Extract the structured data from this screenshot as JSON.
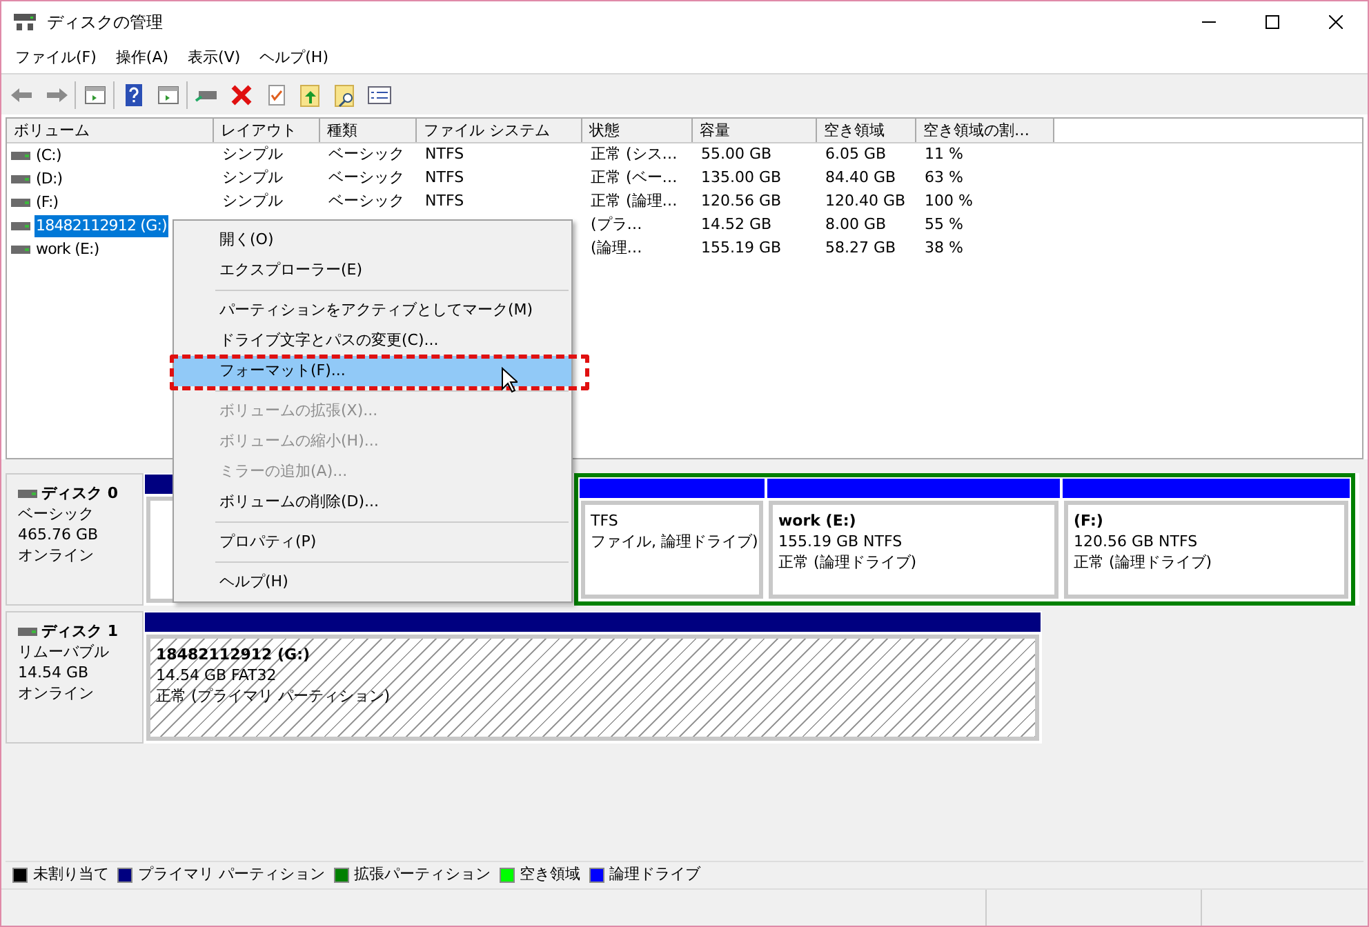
{
  "window": {
    "title": "ディスクの管理"
  },
  "menu_bar": [
    "ファイル(F)",
    "操作(A)",
    "表示(V)",
    "ヘルプ(H)"
  ],
  "table": {
    "columns": [
      "ボリューム",
      "レイアウト",
      "種類",
      "ファイル システム",
      "状態",
      "容量",
      "空き領域",
      "空き領域の割…"
    ],
    "rows": [
      {
        "selected": false,
        "cells": [
          "(C:)",
          "シンプル",
          "ベーシック",
          "NTFS",
          "正常 (シス…",
          "55.00 GB",
          "6.05 GB",
          "11 %"
        ]
      },
      {
        "selected": false,
        "cells": [
          "(D:)",
          "シンプル",
          "ベーシック",
          "NTFS",
          "正常 (ベー…",
          "135.00 GB",
          "84.40 GB",
          "63 %"
        ]
      },
      {
        "selected": false,
        "cells": [
          "(F:)",
          "シンプル",
          "ベーシック",
          "NTFS",
          "正常 (論理…",
          "120.56 GB",
          "120.40 GB",
          "100 %"
        ]
      },
      {
        "selected": true,
        "cells": [
          "18482112912 (G:)",
          "",
          "",
          "",
          "(プラ…",
          "14.52 GB",
          "8.00 GB",
          "55 %"
        ]
      },
      {
        "selected": false,
        "cells": [
          "work (E:)",
          "",
          "",
          "",
          "(論理…",
          "155.19 GB",
          "58.27 GB",
          "38 %"
        ]
      }
    ]
  },
  "disks": [
    {
      "name": "ディスク 0",
      "type": "ベーシック",
      "size": "465.76 GB",
      "status": "オンライン",
      "partitions": [
        {
          "color": "#000080"
        },
        {
          "color": "#0000ff",
          "extended": true,
          "lines": [
            "TFS",
            "ファイル, 論理ドライブ)"
          ]
        },
        {
          "color": "#0000ff",
          "extended": true,
          "title": "work  (E:)",
          "lines": [
            "155.19 GB NTFS",
            "正常 (論理ドライブ)"
          ]
        },
        {
          "color": "#0000ff",
          "extended": true,
          "title": "(F:)",
          "lines": [
            "120.56 GB NTFS",
            "正常 (論理ドライブ)"
          ]
        }
      ]
    },
    {
      "name": "ディスク 1",
      "type": "リムーバブル",
      "size": "14.54 GB",
      "status": "オンライン",
      "partitions": [
        {
          "color": "#000080",
          "hatched": true,
          "title": "18482112912  (G:)",
          "lines": [
            "14.54 GB FAT32",
            "正常 (プライマリ パーティション)"
          ]
        }
      ]
    }
  ],
  "context_menu": [
    {
      "kind": "item",
      "label": "開く(O)",
      "disabled": false,
      "selected": false
    },
    {
      "kind": "item",
      "label": "エクスプローラー(E)",
      "disabled": false,
      "selected": false
    },
    {
      "kind": "separator"
    },
    {
      "kind": "item",
      "label": "パーティションをアクティブとしてマーク(M)",
      "disabled": false,
      "selected": false
    },
    {
      "kind": "item",
      "label": "ドライブ文字とパスの変更(C)...",
      "disabled": false,
      "selected": false
    },
    {
      "kind": "item",
      "label": "フォーマット(F)...",
      "disabled": false,
      "selected": true
    },
    {
      "kind": "separator"
    },
    {
      "kind": "item",
      "label": "ボリュームの拡張(X)...",
      "disabled": true,
      "selected": false
    },
    {
      "kind": "item",
      "label": "ボリュームの縮小(H)...",
      "disabled": true,
      "selected": false
    },
    {
      "kind": "item",
      "label": "ミラーの追加(A)...",
      "disabled": true,
      "selected": false
    },
    {
      "kind": "item",
      "label": "ボリュームの削除(D)...",
      "disabled": false,
      "selected": false
    },
    {
      "kind": "separator"
    },
    {
      "kind": "item",
      "label": "プロパティ(P)",
      "disabled": false,
      "selected": false
    },
    {
      "kind": "separator"
    },
    {
      "kind": "item",
      "label": "ヘルプ(H)",
      "disabled": false,
      "selected": false
    }
  ],
  "legend": [
    {
      "label": "未割り当て",
      "color": "#000000"
    },
    {
      "label": "プライマリ パーティション",
      "color": "#000080"
    },
    {
      "label": "拡張パーティション",
      "color": "#008000"
    },
    {
      "label": "空き領域",
      "color": "#00ff00"
    },
    {
      "label": "論理ドライブ",
      "color": "#0000ff"
    }
  ]
}
